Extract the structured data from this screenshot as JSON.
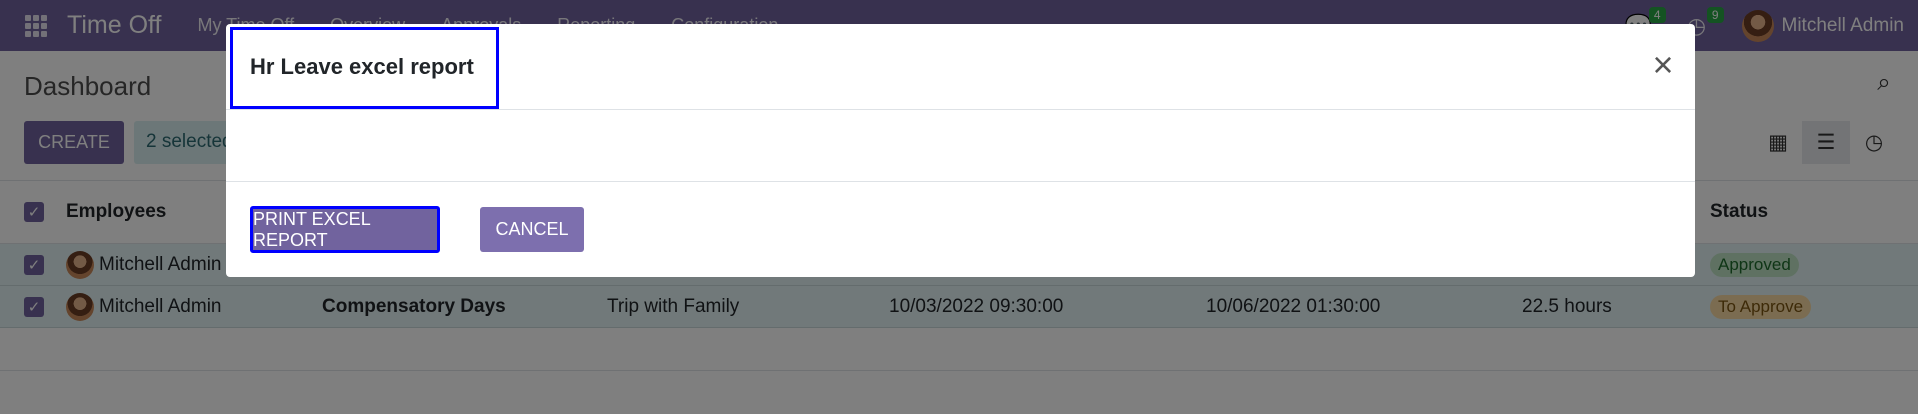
{
  "navbar": {
    "brand": "Time Off",
    "menu": [
      "My Time Off",
      "Overview",
      "Approvals",
      "Reporting",
      "Configuration"
    ],
    "messages_count": "4",
    "activities_count": "9",
    "user_name": "Mitchell Admin"
  },
  "control_panel": {
    "breadcrumb": "Dashboard",
    "create_label": "CREATE",
    "selection": "2 selected"
  },
  "list": {
    "headers": {
      "employees": "Employees",
      "status": "Status"
    },
    "rows": [
      {
        "employee": "Mitchell Admin",
        "status": "Approved"
      },
      {
        "employee": "Mitchell Admin",
        "type": "Compensatory Days",
        "description": "Trip with Family",
        "start": "10/03/2022 09:30:00",
        "end": "10/06/2022 01:30:00",
        "duration": "22.5 hours",
        "status": "To Approve"
      }
    ]
  },
  "modal": {
    "title": "Hr Leave excel report",
    "print_label": "PRINT EXCEL REPORT",
    "cancel_label": "CANCEL"
  },
  "icons": {
    "apps": "apps-grid-icon",
    "chat": "chat-icon",
    "clock": "clock-icon",
    "search": "search-icon",
    "next": "chevron-right-icon",
    "calendar": "calendar-icon",
    "list": "list-icon",
    "activity": "activity-clock-icon",
    "close": "close-icon"
  },
  "colors": {
    "brand": "#71639e",
    "highlight_frame": "#0000ff",
    "selected_row": "#e2f3f5"
  }
}
